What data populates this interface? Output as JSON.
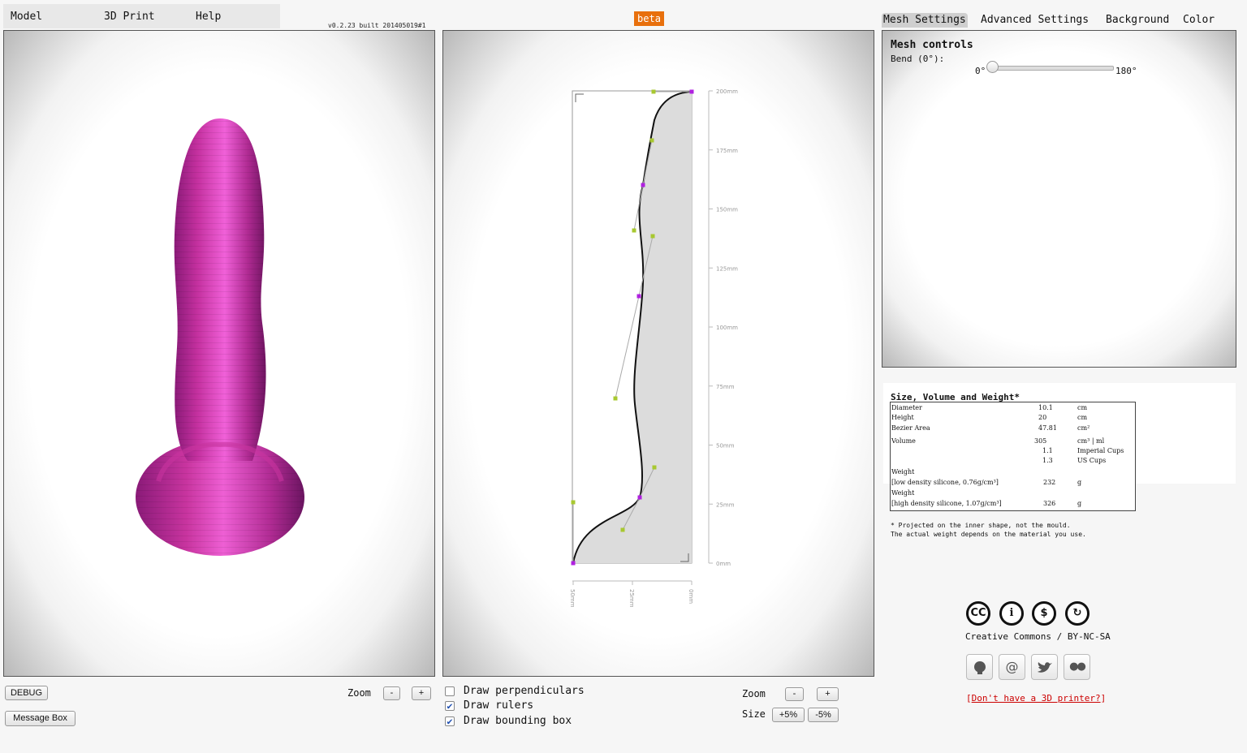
{
  "menu": {
    "model": "Model",
    "print": "3D Print",
    "help": "Help"
  },
  "version": "v0.2.23 built 201405019#1",
  "beta": "beta",
  "tabs": [
    "Mesh Settings",
    "Advanced Settings",
    "Background",
    "Color"
  ],
  "mesh": {
    "title": "Mesh controls",
    "bend_label": "Bend (0°):",
    "bend_min": "0°",
    "bend_max": "180°",
    "bend_value_deg": 0
  },
  "left_controls": {
    "debug": "DEBUG",
    "message_box": "Message Box",
    "zoom": "Zoom",
    "minus": "-",
    "plus": "+"
  },
  "mid_controls": {
    "draw_perpendiculars": "Draw perpendiculars",
    "draw_rulers": "Draw rulers",
    "draw_bounding_box": "Draw bounding box",
    "perpendiculars_checked": false,
    "rulers_checked": true,
    "bbox_checked": true,
    "zoom": "Zoom",
    "minus": "-",
    "plus": "+",
    "size": "Size",
    "size_plus": "+5%",
    "size_minus": "-5%",
    "check_mark": "✔"
  },
  "bezier_rulers": {
    "y_ticks": [
      "200mm",
      "175mm",
      "150mm",
      "125mm",
      "100mm",
      "75mm",
      "50mm",
      "25mm",
      "0mm"
    ],
    "x_ticks": [
      "50mm",
      "25mm",
      "0mm"
    ]
  },
  "stats": {
    "title": "Size, Volume and Weight*",
    "rows": [
      {
        "label": "Diameter",
        "value": "10.1",
        "unit": "cm"
      },
      {
        "label": "Height",
        "value": "20",
        "unit": "cm"
      },
      {
        "label": "Bezier Area",
        "value": "47.81",
        "unit": "cm²"
      },
      {
        "label": "Volume",
        "value": "305",
        "unit": "cm³ | ml"
      },
      {
        "label": "",
        "value": "1.1",
        "unit": "Imperial Cups"
      },
      {
        "label": "",
        "value": "1.3",
        "unit": "US Cups"
      },
      {
        "label": "Weight",
        "value": "",
        "unit": ""
      },
      {
        "label": " [low density silicone, 0.76g/cm³]",
        "value": "232",
        "unit": "g"
      },
      {
        "label": "Weight",
        "value": "",
        "unit": ""
      },
      {
        "label": " [high density silicone, 1.07g/cm³]",
        "value": "326",
        "unit": "g"
      }
    ],
    "footnote1": "* Projected on the inner shape, not the mould.",
    "footnote2": "The actual weight depends on the material you use."
  },
  "license": {
    "text": "Creative Commons / BY-NC-SA",
    "icons": [
      "CC",
      "i",
      "$",
      "↻"
    ]
  },
  "social_icons": [
    "",
    "@",
    "",
    "●●"
  ],
  "no_printer": {
    "open": "[",
    "link": "Don't have a 3D printer?",
    "close": "]"
  },
  "colors": {
    "shape": "#e040c8",
    "beta": "#e8700d",
    "control_point": "#a8c830",
    "anchor_point": "#b020e0"
  }
}
